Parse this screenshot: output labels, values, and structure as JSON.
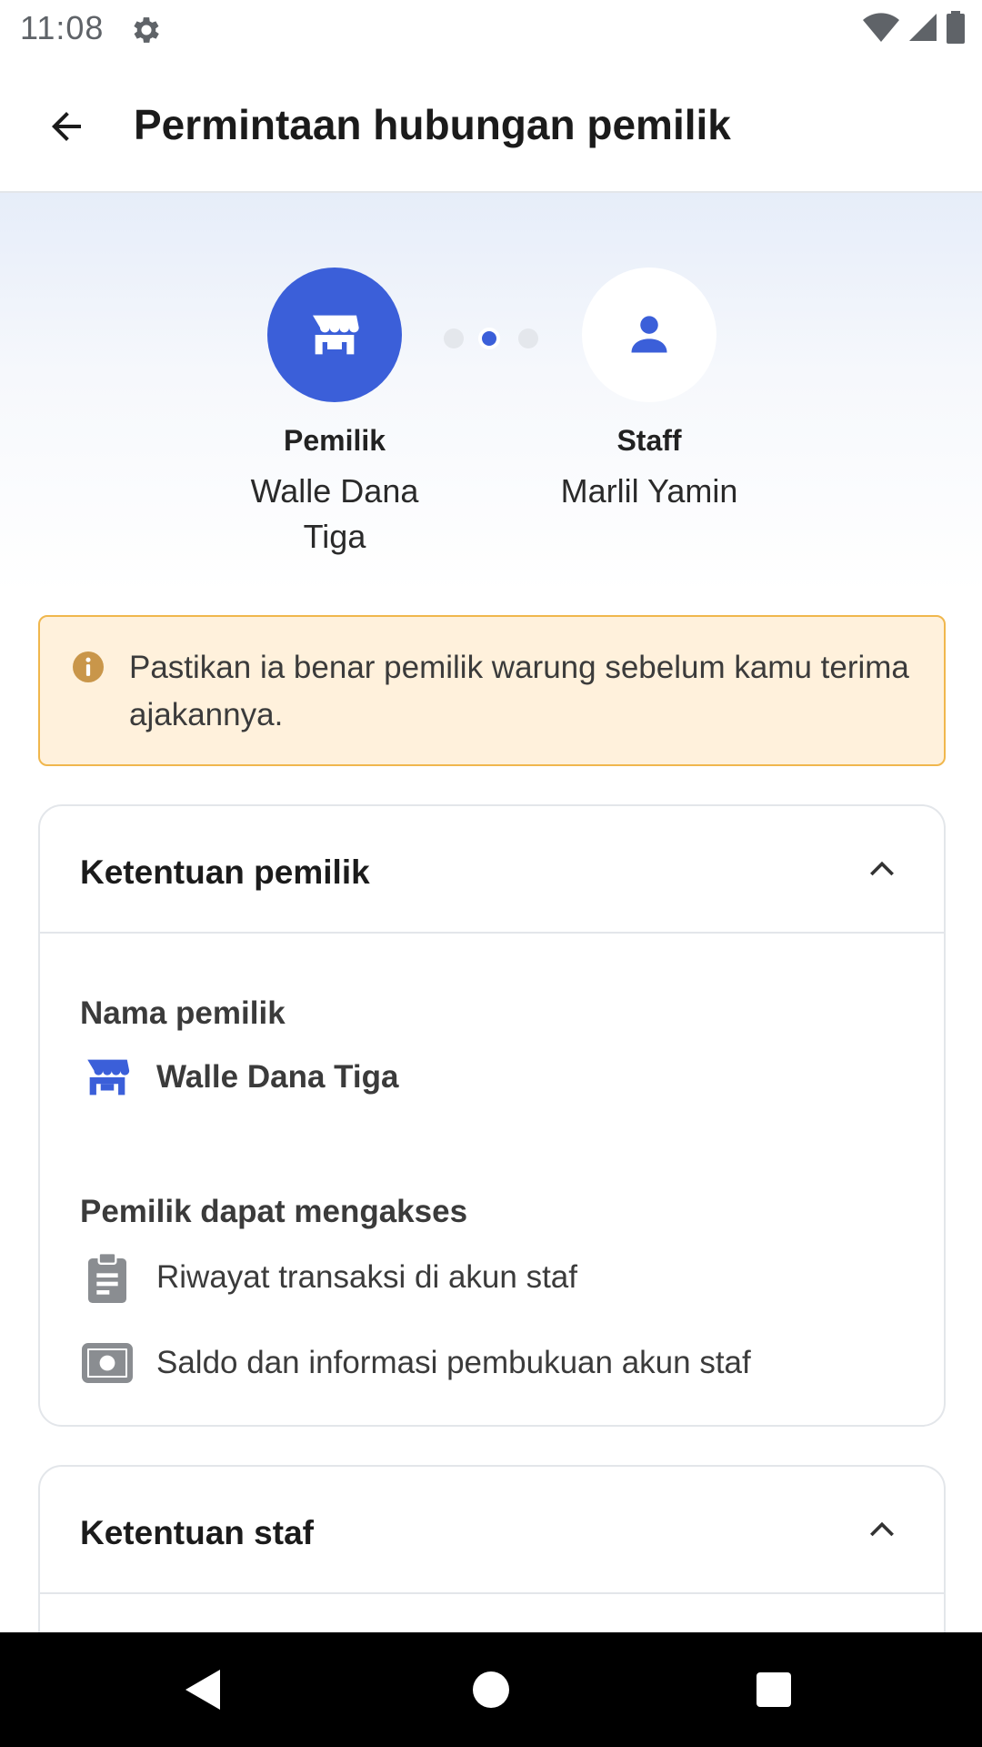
{
  "status_bar": {
    "time": "11:08"
  },
  "app_bar": {
    "title": "Permintaan hubungan pemilik"
  },
  "hero": {
    "owner": {
      "role": "Pemilik",
      "name": "Walle Dana Tiga"
    },
    "staff": {
      "role": "Staff",
      "name": "Marlil Yamin"
    }
  },
  "warning": {
    "text": "Pastikan ia benar pemilik warung sebelum kamu terima ajakannya."
  },
  "owner_terms": {
    "title": "Ketentuan pemilik",
    "owner_name_label": "Nama pemilik",
    "owner_name": "Walle Dana Tiga",
    "access_label": "Pemilik dapat mengakses",
    "access_items": [
      "Riwayat transaksi di akun staf",
      "Saldo dan informasi pembukuan akun staf"
    ]
  },
  "staff_terms": {
    "title": "Ketentuan staf"
  },
  "colors": {
    "accent": "#3b5fd9",
    "warning_bg": "#fff1dc",
    "warning_border": "#f0b74d",
    "warning_icon": "#c9964a"
  },
  "icons": {
    "status": [
      "gear-icon",
      "wifi-icon",
      "signal-icon",
      "battery-icon"
    ],
    "hero_owner": "store-icon",
    "hero_staff": "person-icon",
    "access_items": [
      "clipboard-icon",
      "money-icon"
    ],
    "nav": [
      "back-triangle-icon",
      "home-circle-icon",
      "recents-square-icon"
    ]
  }
}
